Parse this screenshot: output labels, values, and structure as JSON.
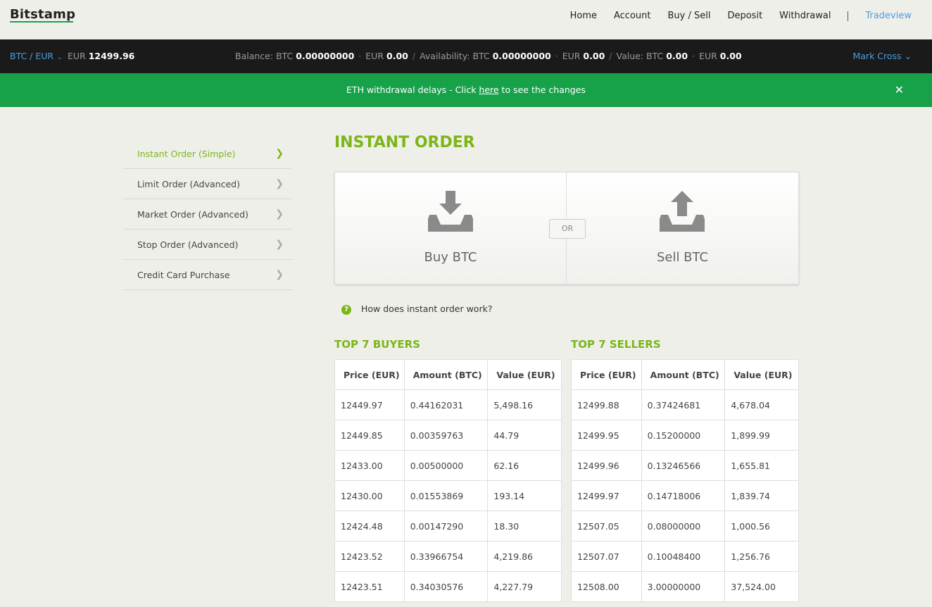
{
  "header": {
    "logo": "Bitstamp",
    "nav": [
      "Home",
      "Account",
      "Buy / Sell",
      "Deposit",
      "Withdrawal"
    ],
    "tradeview": "Tradeview"
  },
  "ticker": {
    "pair": "BTC / EUR",
    "price_currency": "EUR",
    "price": "12499.96",
    "balance_label": "Balance:",
    "availability_label": "Availability:",
    "value_label": "Value:",
    "btc": "BTC",
    "eur": "EUR",
    "balance_btc": "0.00000000",
    "balance_eur": "0.00",
    "availability_btc": "0.00000000",
    "availability_eur": "0.00",
    "value_btc": "0.00",
    "value_eur": "0.00",
    "user": "Mark Cross"
  },
  "banner": {
    "text_before": "ETH withdrawal delays - Click ",
    "link": "here",
    "text_after": " to see the changes",
    "close": "✕"
  },
  "sidemenu": [
    "Instant Order (Simple)",
    "Limit Order (Advanced)",
    "Market Order (Advanced)",
    "Stop Order (Advanced)",
    "Credit Card Purchase"
  ],
  "main": {
    "title": "INSTANT ORDER",
    "buy_label": "Buy BTC",
    "sell_label": "Sell BTC",
    "or_label": "OR",
    "howto": "How does instant order work?"
  },
  "buyers": {
    "title": "TOP 7 BUYERS",
    "columns": [
      "Price (EUR)",
      "Amount (BTC)",
      "Value (EUR)"
    ],
    "rows": [
      [
        "12449.97",
        "0.44162031",
        "5,498.16"
      ],
      [
        "12449.85",
        "0.00359763",
        "44.79"
      ],
      [
        "12433.00",
        "0.00500000",
        "62.16"
      ],
      [
        "12430.00",
        "0.01553869",
        "193.14"
      ],
      [
        "12424.48",
        "0.00147290",
        "18.30"
      ],
      [
        "12423.52",
        "0.33966754",
        "4,219.86"
      ],
      [
        "12423.51",
        "0.34030576",
        "4,227.79"
      ]
    ]
  },
  "sellers": {
    "title": "TOP 7 SELLERS",
    "columns": [
      "Price (EUR)",
      "Amount (BTC)",
      "Value (EUR)"
    ],
    "rows": [
      [
        "12499.88",
        "0.37424681",
        "4,678.04"
      ],
      [
        "12499.95",
        "0.15200000",
        "1,899.99"
      ],
      [
        "12499.96",
        "0.13246566",
        "1,655.81"
      ],
      [
        "12499.97",
        "0.14718006",
        "1,839.74"
      ],
      [
        "12507.05",
        "0.08000000",
        "1,000.56"
      ],
      [
        "12507.07",
        "0.10048400",
        "1,256.76"
      ],
      [
        "12508.00",
        "3.00000000",
        "37,524.00"
      ]
    ]
  }
}
